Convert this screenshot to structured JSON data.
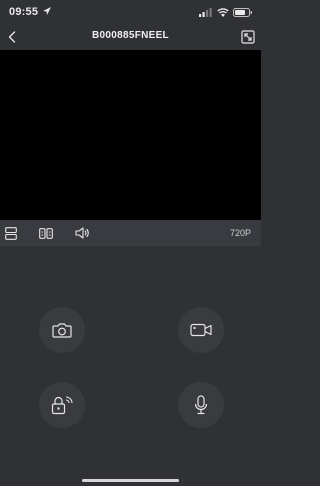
{
  "status_bar": {
    "time": "09:55"
  },
  "nav": {
    "title": "B000885FNEEL"
  },
  "toolbar": {
    "quality_label": "720P"
  },
  "icons": {
    "back": "chevron-left-icon",
    "fullscreen": "fullscreen-icon",
    "split": "split-view-icon",
    "layout": "dual-view-icon",
    "sound": "speaker-icon",
    "snapshot": "camera-icon",
    "record": "video-record-icon",
    "unlock": "unlock-icon",
    "talk": "microphone-icon"
  },
  "colors": {
    "background": "#2f3135",
    "video": "#000000",
    "toolbar": "#393b40",
    "button": "#393b3f",
    "icon": "#e6e6e6"
  }
}
